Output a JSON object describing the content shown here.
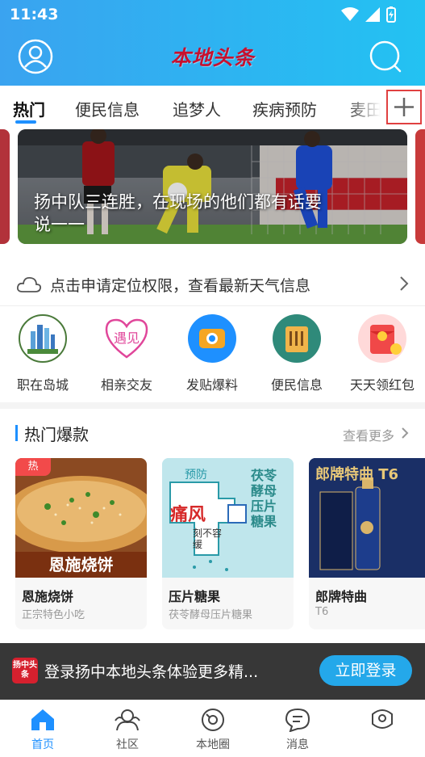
{
  "status_bar": {
    "time": "11:43"
  },
  "header": {
    "logo_text": "本地头条"
  },
  "tabs": [
    {
      "label": "热门"
    },
    {
      "label": "便民信息"
    },
    {
      "label": "追梦人"
    },
    {
      "label": "疾病预防"
    },
    {
      "label": "麦田"
    }
  ],
  "banner": {
    "title": "扬中队三连胜，在现场的他们都有话要说一一"
  },
  "weather": {
    "text": "点击申请定位权限，查看最新天气信息"
  },
  "shortcuts": [
    {
      "label": "职在岛城",
      "icon": "city-skyline-icon"
    },
    {
      "label": "相亲交友",
      "icon": "heart-icon"
    },
    {
      "label": "发贴爆料",
      "icon": "camera-icon"
    },
    {
      "label": "便民信息",
      "icon": "info-board-icon"
    },
    {
      "label": "天天领红包",
      "icon": "red-packet-icon"
    }
  ],
  "hot_section": {
    "title": "热门爆款",
    "more": "查看更多"
  },
  "products": [
    {
      "name": "恩施烧饼",
      "desc": "正宗特色小吃",
      "badge": "热",
      "image_text": "恩施烧饼"
    },
    {
      "name": "压片糖果",
      "desc": "茯苓酵母压片糖果",
      "image_text_1": "预防",
      "image_text_2": "痛风",
      "image_text_3": "刻不容缓",
      "image_text_4": "茯苓酵母压片糖果"
    },
    {
      "name": "郎牌特曲",
      "desc": "T6",
      "image_text": "郎牌特曲 T6"
    }
  ],
  "login_bar": {
    "logo_text": "扬中头条",
    "text": "登录扬中本地头条体验更多精...",
    "button": "立即登录"
  },
  "bottom_nav": [
    {
      "label": "首页",
      "icon": "home-icon"
    },
    {
      "label": "社区",
      "icon": "community-icon"
    },
    {
      "label": "本地圈",
      "icon": "local-circle-icon"
    },
    {
      "label": "消息",
      "icon": "message-icon"
    },
    {
      "label": "",
      "icon": "profile-icon"
    }
  ],
  "colors": {
    "accent": "#1e90ff",
    "header_start": "#3aa3f0",
    "header_end": "#23c2f2",
    "logo": "#c8102e",
    "hot": "#f24a4a"
  }
}
